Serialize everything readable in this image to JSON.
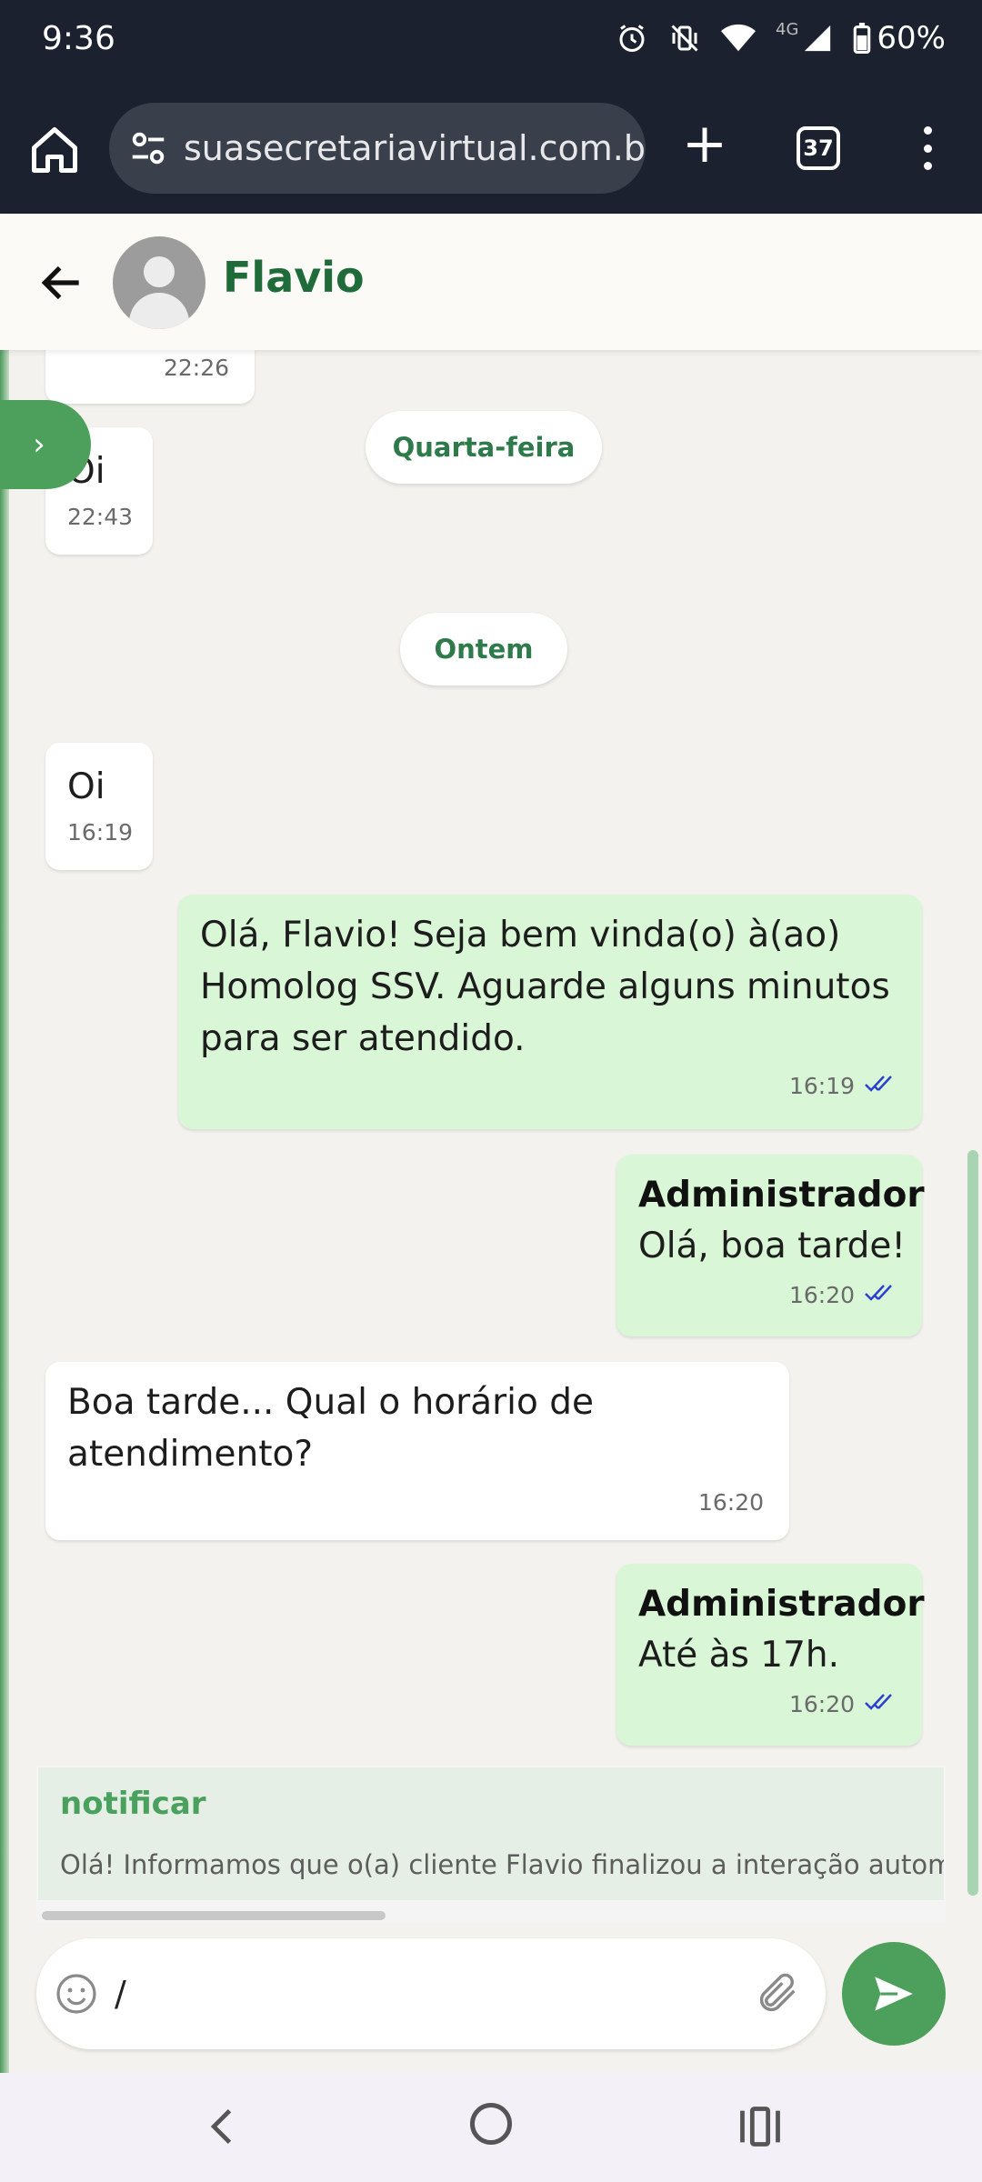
{
  "status_bar": {
    "time": "9:36",
    "network": "4G",
    "battery": "60%"
  },
  "browser": {
    "url": "suasecretariavirtual.com.br",
    "tab_count": "37"
  },
  "chat_header": {
    "contact_name": "Flavio"
  },
  "messages": [
    {
      "type": "in",
      "text": "",
      "time": "22:26"
    },
    {
      "type": "day",
      "text": "Quarta-feira"
    },
    {
      "type": "in",
      "text": "Oi",
      "time": "22:43"
    },
    {
      "type": "day",
      "text": "Ontem"
    },
    {
      "type": "in",
      "text": "Oi",
      "time": "16:19"
    },
    {
      "type": "out",
      "text": "Olá, Flavio! Seja bem vinda(o) à(ao) Homolog SSV. Aguarde alguns minutos para ser atendido.",
      "time": "16:19"
    },
    {
      "type": "out",
      "sender": "Administrador",
      "text": "Olá, boa tarde!",
      "time": "16:20"
    },
    {
      "type": "in",
      "text": "Boa tarde... Qual o horário de atendimento?",
      "time": "16:20"
    },
    {
      "type": "out",
      "sender": "Administrador",
      "text": "Até às 17h.",
      "time": "16:20"
    }
  ],
  "quick_reply": {
    "title": "notificar",
    "preview": "Olá! Informamos que o(a) cliente Flavio finalizou a interação automática"
  },
  "composer": {
    "value": "/"
  },
  "colors": {
    "accent": "#4ca05c",
    "outgoing_bubble": "#d9f7d6",
    "read_ticks": "#2b3fd1"
  },
  "icons": [
    "alarm-icon",
    "vibrate-off-icon",
    "wifi-icon",
    "signal-icon",
    "battery-icon",
    "home-icon",
    "site-settings-icon",
    "plus-icon",
    "tabs-icon",
    "more-vert-icon",
    "back-arrow-icon",
    "chevron-right-icon",
    "emoji-icon",
    "attach-icon",
    "send-icon",
    "nav-back-icon",
    "nav-home-icon",
    "nav-recents-icon"
  ]
}
